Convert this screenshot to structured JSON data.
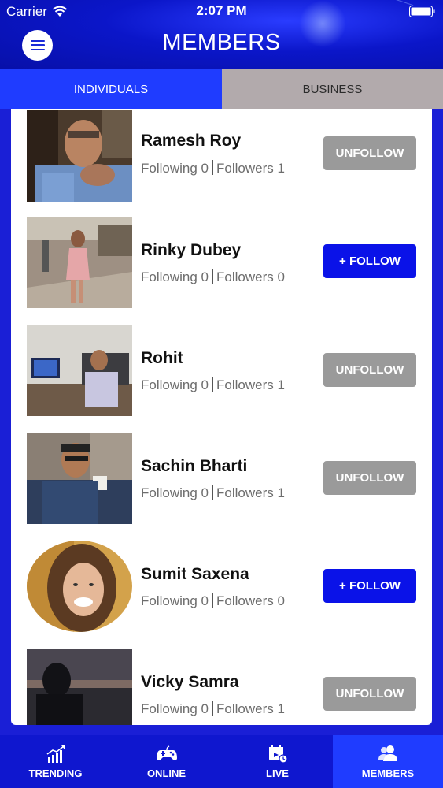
{
  "status_bar": {
    "carrier": "Carrier",
    "time": "2:07 PM"
  },
  "header": {
    "title": "MEMBERS"
  },
  "tabs": [
    {
      "label": "INDIVIDUALS",
      "active": true
    },
    {
      "label": "BUSINESS",
      "active": false
    }
  ],
  "members": [
    {
      "name": "Ramesh Roy",
      "following_label": "Following 0",
      "followers_label": "Followers 1",
      "action": "UNFOLLOW"
    },
    {
      "name": "Rinky Dubey",
      "following_label": "Following 0",
      "followers_label": "Followers 0",
      "action": "+ FOLLOW"
    },
    {
      "name": "Rohit",
      "following_label": "Following 0",
      "followers_label": "Followers 1",
      "action": "UNFOLLOW"
    },
    {
      "name": "Sachin Bharti",
      "following_label": "Following 0",
      "followers_label": "Followers 1",
      "action": "UNFOLLOW"
    },
    {
      "name": "Sumit Saxena",
      "following_label": "Following 0",
      "followers_label": "Followers 0",
      "action": "+ FOLLOW"
    },
    {
      "name": "Vicky Samra",
      "following_label": "Following 0",
      "followers_label": "Followers 1",
      "action": "UNFOLLOW"
    }
  ],
  "bottom_nav": [
    {
      "label": "TRENDING",
      "icon": "trending-chart-icon",
      "active": false
    },
    {
      "label": "ONLINE",
      "icon": "gamepad-icon",
      "active": false
    },
    {
      "label": "LIVE",
      "icon": "calendar-clock-icon",
      "active": false
    },
    {
      "label": "MEMBERS",
      "icon": "members-icon",
      "active": true
    }
  ],
  "colors": {
    "header_blue": "#0b16c9",
    "tab_active": "#1f3cff",
    "tab_inactive": "#b2aaac",
    "follow_button": "#0a12e8",
    "unfollow_button": "#9a9a9a"
  }
}
